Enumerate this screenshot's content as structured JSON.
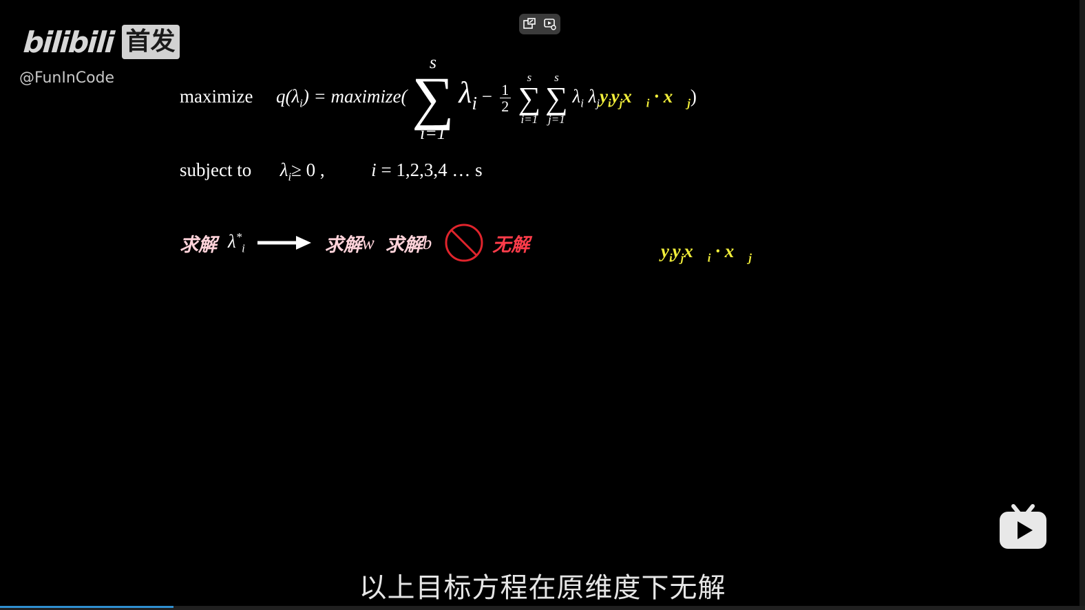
{
  "logo": {
    "brand": "bilibili",
    "badge": "首发",
    "handle": "@FunInCode"
  },
  "controls": {
    "pip_icon": "pip-exit-icon",
    "settings_icon": "video-settings-icon"
  },
  "formula": {
    "maximize_label": "maximize",
    "q_lhs": "q(λ",
    "q_sub": "i",
    "q_close": ") = maximize(",
    "sum_top": "s",
    "sum_bottom": "i=1",
    "lambda_i": "λ",
    "lambda_i_sub": "i",
    "minus": "−",
    "half_num": "1",
    "half_den": "2",
    "sum2_top": "s",
    "sum2_bottom": "i=1",
    "sum3_top": "s",
    "sum3_bottom": "j=1",
    "lambda_pair": "λ",
    "yellow_term": "y",
    "dot": "·",
    "close": ")"
  },
  "constraint": {
    "label": "subject to",
    "lambda": "λ",
    "lambda_sub": "i",
    "geq": "≥ 0 ,",
    "index_eq": "= 1,2,3,4 … s",
    "index_var": "i"
  },
  "solve": {
    "step1": "求解",
    "lambda_star": "λ",
    "star": "*",
    "star_sub": "i",
    "step2": "求解",
    "w": "w",
    "step3": "求解",
    "b": "b",
    "no_solution": "无解"
  },
  "side_term": {
    "label": "y"
  },
  "subtitle": "以上目标方程在原维度下无解",
  "progress": {
    "fraction": 0.16
  },
  "colors": {
    "highlight": "#f1ee3a",
    "pink": "#ffd3da",
    "red": "#ff3c4a",
    "progress": "#2f8fd1"
  }
}
